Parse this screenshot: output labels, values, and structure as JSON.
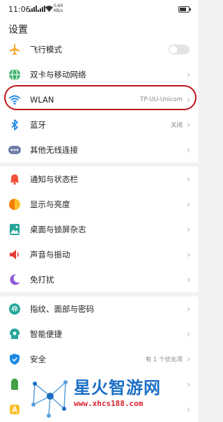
{
  "status_bar": {
    "time": "11:06",
    "network": "0.60 KB/s"
  },
  "header": {
    "title": "设置"
  },
  "groups": [
    {
      "items": [
        {
          "label": "飞行模式",
          "icon": "airplane-icon",
          "control": "toggle",
          "on": false
        },
        {
          "label": "双卡与移动网络",
          "icon": "globe-icon",
          "chevron": "›"
        },
        {
          "label": "WLAN",
          "icon": "wifi-icon",
          "value": "TP-UU-Unicom",
          "chevron": "›"
        },
        {
          "label": "蓝牙",
          "icon": "bluetooth-icon",
          "value": "关闭",
          "chevron": "›"
        },
        {
          "label": "其他无线连接",
          "icon": "more-dots-icon",
          "chevron": "›"
        }
      ]
    },
    {
      "items": [
        {
          "label": "通知与状态栏",
          "icon": "bell-icon",
          "chevron": "›"
        },
        {
          "label": "显示与亮度",
          "icon": "brightness-icon",
          "chevron": "›"
        },
        {
          "label": "桌面与锁屏杂志",
          "icon": "wallpaper-icon",
          "chevron": "›"
        },
        {
          "label": "声音与振动",
          "icon": "speaker-icon",
          "chevron": "›"
        },
        {
          "label": "免打扰",
          "icon": "moon-icon",
          "chevron": "›"
        }
      ]
    },
    {
      "items": [
        {
          "label": "指纹、面部与密码",
          "icon": "fingerprint-icon",
          "chevron": "›"
        },
        {
          "label": "智能便捷",
          "icon": "smart-assist-icon",
          "chevron": "›"
        },
        {
          "label": "安全",
          "icon": "shield-icon",
          "value": "有 1 个优化项",
          "chevron": "›"
        },
        {
          "label": "",
          "icon": "battery-icon",
          "chevron": "›"
        },
        {
          "label": "",
          "icon": "language-icon",
          "chevron": "›"
        }
      ]
    }
  ],
  "watermark": {
    "title": "星火智游网",
    "url": "www.xhcs188.com"
  },
  "colors": {
    "highlight": "#c0141b",
    "accent_blue": "#1e88e5"
  }
}
